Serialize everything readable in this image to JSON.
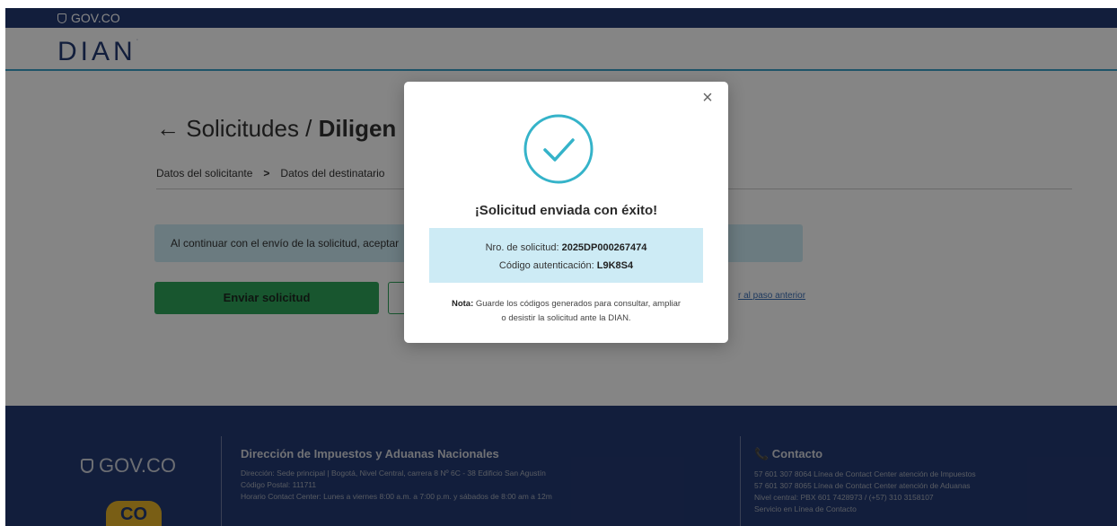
{
  "gov_bar": {
    "label": "GOV.CO"
  },
  "header": {
    "logo": "DIAN",
    "logo_mark": "·"
  },
  "page": {
    "title_prefix": "← Solicitudes / ",
    "title_bold": "Diligen",
    "steps": [
      "Datos del solicitante",
      "Datos del destinatario"
    ],
    "step_separator": ">",
    "notice": "Al continuar con el envío de la solicitud, aceptar",
    "send_button": "Enviar solicitud",
    "prev_link": "r al paso anterior"
  },
  "modal": {
    "close_glyph": "×",
    "title": "¡Solicitud enviada con éxito!",
    "request_label": "Nro. de solicitud: ",
    "request_value": "2025DP000267474",
    "auth_label": "Código autenticación: ",
    "auth_value": "L9K8S4",
    "note_label": "Nota:",
    "note_line1": " Guarde los códigos generados para consultar, ampliar",
    "note_line2": "o desistir la solicitud ante la DIAN."
  },
  "footer": {
    "gov_label": "GOV.CO",
    "badge": "CO",
    "org_title": "Dirección de Impuestos y Aduanas Nacionales",
    "org_lines": [
      "Dirección: Sede principal | Bogotá, Nivel Central, carrera 8 Nº 6C - 38 Edificio San Agustín",
      "Código Postal: 111711",
      "Horario Contact Center: Lunes a viernes 8:00 a.m. a 7:00 p.m. y sábados de 8:00 am a 12m"
    ],
    "contact_title": "📞 Contacto",
    "contact_lines": [
      "57 601 307 8064 Línea de Contact Center atención de Impuestos",
      "57 601 307 8065 Línea de Contact Center atención de Aduanas",
      "Nivel central: PBX 601 7428973 / (+57) 310 3158107",
      "Servicio en Línea de Contacto"
    ]
  },
  "colors": {
    "gov_blue": "#243a73",
    "accent_teal": "#3aa2c7",
    "success_green": "#2ea55a",
    "info_bg": "#cdebf5"
  }
}
